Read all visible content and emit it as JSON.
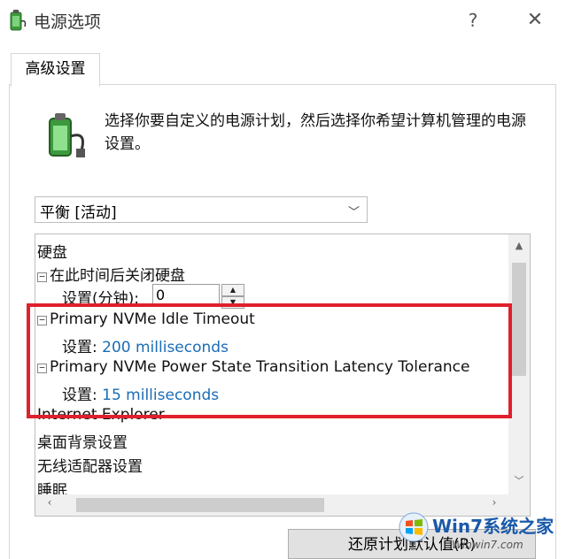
{
  "window": {
    "title": "电源选项",
    "help_glyph": "?",
    "close_glyph": "✕"
  },
  "tabs": [
    {
      "label": "高级设置"
    }
  ],
  "description": "选择你要自定义的电源计划，然后选择你希望计算机管理的电源设置。",
  "plan_select": {
    "value": "平衡 [活动]",
    "chevron": "﹀"
  },
  "tree": {
    "items": [
      {
        "label": "硬盘"
      },
      {
        "expander": "−",
        "label": "在此时间后关闭硬盘"
      },
      {
        "setting_label": "设置(分钟):",
        "value": "0"
      },
      {
        "expander": "−",
        "label": "Primary NVMe Idle Timeout"
      },
      {
        "setting_label": "设置:",
        "value": "200 milliseconds"
      },
      {
        "expander": "−",
        "label": "Primary NVMe Power State Transition Latency Tolerance"
      },
      {
        "setting_label": "设置:",
        "value": "15 milliseconds"
      },
      {
        "label": "Internet Explorer"
      },
      {
        "label": "桌面背景设置"
      },
      {
        "label": "无线适配器设置"
      },
      {
        "label": "睡眠"
      }
    ],
    "spinner": {
      "up": "▲",
      "down": "▼"
    },
    "scroll_glyphs": {
      "up": "▲",
      "down": "﹀",
      "left": "‹",
      "right": "›"
    }
  },
  "buttons": {
    "restore_defaults": "还原计划默认值(R)"
  },
  "watermark": {
    "brand": "Win7系统之家",
    "site": "Winwin7.com"
  },
  "colors": {
    "highlight": "#e0202c",
    "link": "#1b6cb5"
  },
  "icons": {
    "app": "battery-plug-icon",
    "description": "battery-plug-icon"
  }
}
